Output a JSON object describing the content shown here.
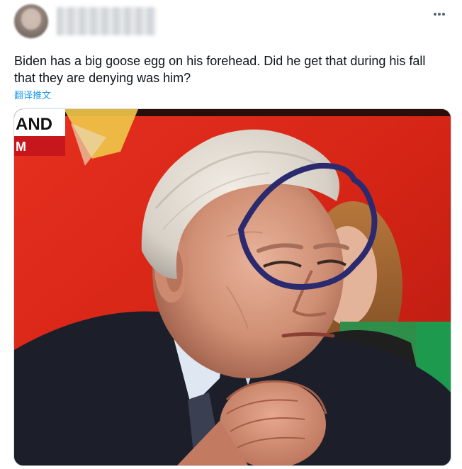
{
  "tweet": {
    "text": "Biden has a big goose egg on his forehead. Did he get that during his fall that they are denying was him?",
    "translate_label": "翻译推文",
    "more_icon": "more-horizontal-icon"
  },
  "media": {
    "banner_line1": "AND",
    "banner_line2": "M",
    "colors": {
      "background_red": "#e02a1c",
      "circle": "#2b2a6e"
    }
  }
}
